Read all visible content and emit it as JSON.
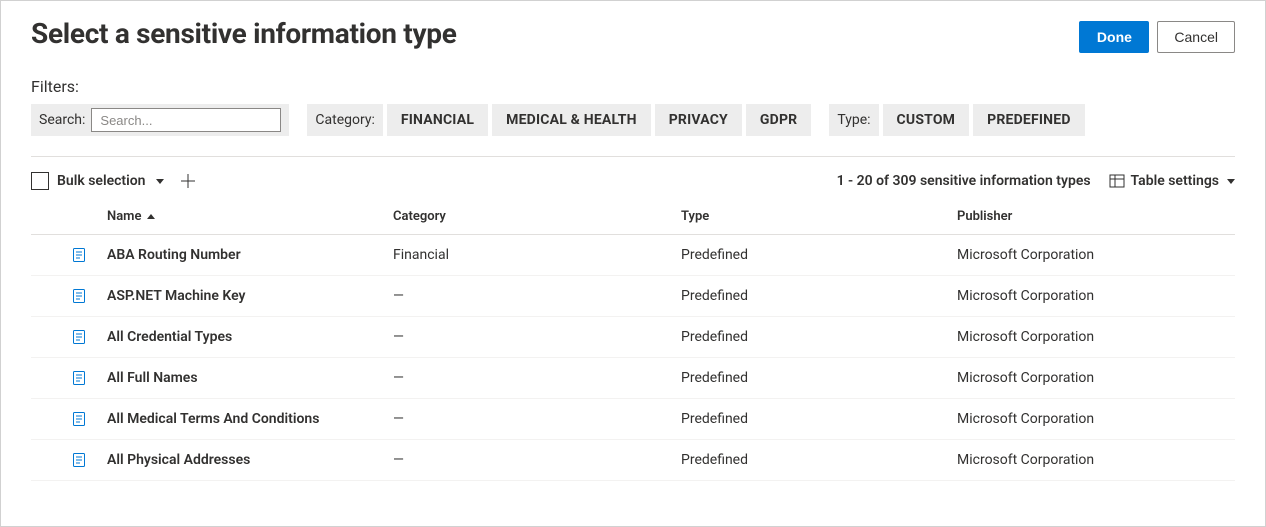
{
  "header": {
    "title": "Select a sensitive information type",
    "done": "Done",
    "cancel": "Cancel"
  },
  "filters": {
    "label": "Filters:",
    "search_label": "Search:",
    "search_placeholder": "Search...",
    "search_value": "",
    "category_label": "Category:",
    "categories": [
      "FINANCIAL",
      "MEDICAL & HEALTH",
      "PRIVACY",
      "GDPR"
    ],
    "type_label": "Type:",
    "types": [
      "CUSTOM",
      "PREDEFINED"
    ]
  },
  "toolbar": {
    "bulk_label": "Bulk selection",
    "status": "1 - 20 of 309 sensitive information types",
    "table_settings": "Table settings"
  },
  "columns": {
    "name": "Name",
    "category": "Category",
    "type": "Type",
    "publisher": "Publisher"
  },
  "rows": [
    {
      "name": "ABA Routing Number",
      "category": "Financial",
      "type": "Predefined",
      "publisher": "Microsoft Corporation"
    },
    {
      "name": "ASP.NET Machine Key",
      "category": "—",
      "type": "Predefined",
      "publisher": "Microsoft Corporation"
    },
    {
      "name": "All Credential Types",
      "category": "—",
      "type": "Predefined",
      "publisher": "Microsoft Corporation"
    },
    {
      "name": "All Full Names",
      "category": "—",
      "type": "Predefined",
      "publisher": "Microsoft Corporation"
    },
    {
      "name": "All Medical Terms And Conditions",
      "category": "—",
      "type": "Predefined",
      "publisher": "Microsoft Corporation"
    },
    {
      "name": "All Physical Addresses",
      "category": "—",
      "type": "Predefined",
      "publisher": "Microsoft Corporation"
    }
  ]
}
